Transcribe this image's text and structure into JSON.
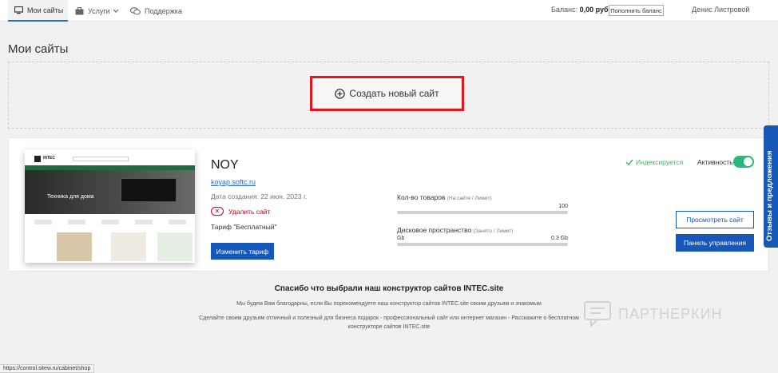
{
  "nav": {
    "my_sites": "Мои сайты",
    "services": "Услуги",
    "support": "Поддержка",
    "balance_label": "Баланс:",
    "balance_value": "0,00 руб.",
    "topup": "Пополнить баланс",
    "user": "Денис Листровой"
  },
  "page_title": "Мои сайты",
  "create_site": "Создать новый сайт",
  "site": {
    "name": "NOY",
    "url": "koyap.softc.ru",
    "created": "Дата создания: 22 июн. 2023 г.",
    "delete": "Удалить сайт",
    "tariff": "Тариф \"Бесплатный\"",
    "change_tariff": "Изменить тариф",
    "products_label": "Кол-во товаров",
    "products_hint": "(На сайте / Лимит)",
    "products_limit": "100",
    "disk_label": "Дисковое пространство",
    "disk_hint": "(Занято / Лимит)",
    "disk_left": "Gb",
    "disk_value": "0.3 Gb",
    "indexing": "Индексируется",
    "activity": "Активность",
    "activity_on": true,
    "view_site": "Просмотреть сайт",
    "control_panel": "Панель управления",
    "preview": {
      "logo_text": "INTEC",
      "hero_text": "Техника для дома"
    }
  },
  "thanks": {
    "title": "Спасибо что выбрали наш конструктор сайтов INTEC.site",
    "line1": "Мы будем Вам благодарны, если Вы порекомендуете наш конструктор сайтов INTEC.site своим друзьям и знакомым",
    "line2": "Сделайте своим друзьям отличный и полезный для бизнеса подарок - профессиональный сайт или интернет магазин - Расскажите о бесплатном конструкторе сайтов INTEC.site"
  },
  "watermark": "ПАРТНЕРКИН",
  "feedback_tab": "Отзывы и предложения",
  "status_url": "https://control.sitew.ru/cabinet/shop",
  "colors": {
    "accent_blue": "#1657b8",
    "highlight_red": "#e3161b",
    "toggle_green": "#27b87a"
  }
}
